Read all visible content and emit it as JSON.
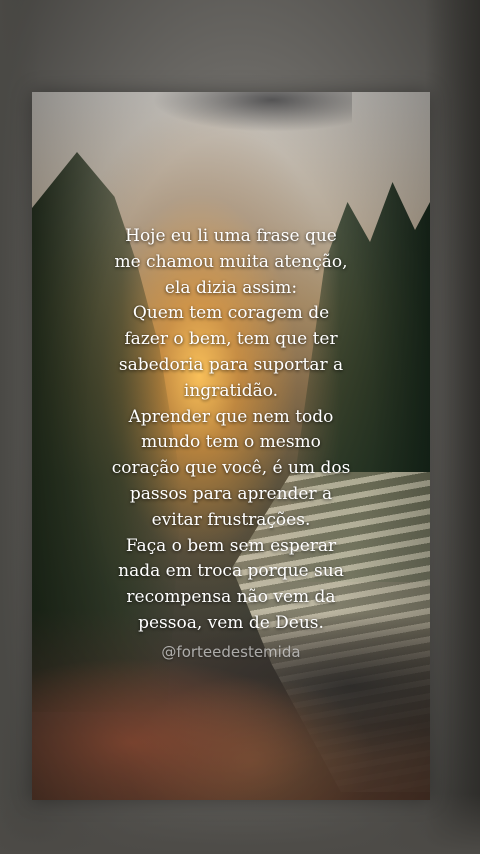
{
  "quote": {
    "lines": [
      "Hoje eu li uma frase que",
      "me chamou muita atenção,",
      "ela dizia assim:",
      "Quem tem coragem de",
      "fazer o bem, tem que ter",
      "sabedoria para suportar a",
      "ingratidão.",
      "Aprender que nem todo",
      "mundo tem o mesmo",
      "coração que você, é um dos",
      "passos para aprender a",
      "evitar frustrações.",
      "Faça o bem sem esperar",
      "nada em troca porque sua",
      "recompensa não vem da",
      "pessoa, vem de Deus."
    ]
  },
  "watermark": {
    "handle": "@forteedestemida"
  },
  "colors": {
    "text": "#ffffff",
    "watermark": "#e1e1e1",
    "background_outer": "#6c6a66"
  }
}
